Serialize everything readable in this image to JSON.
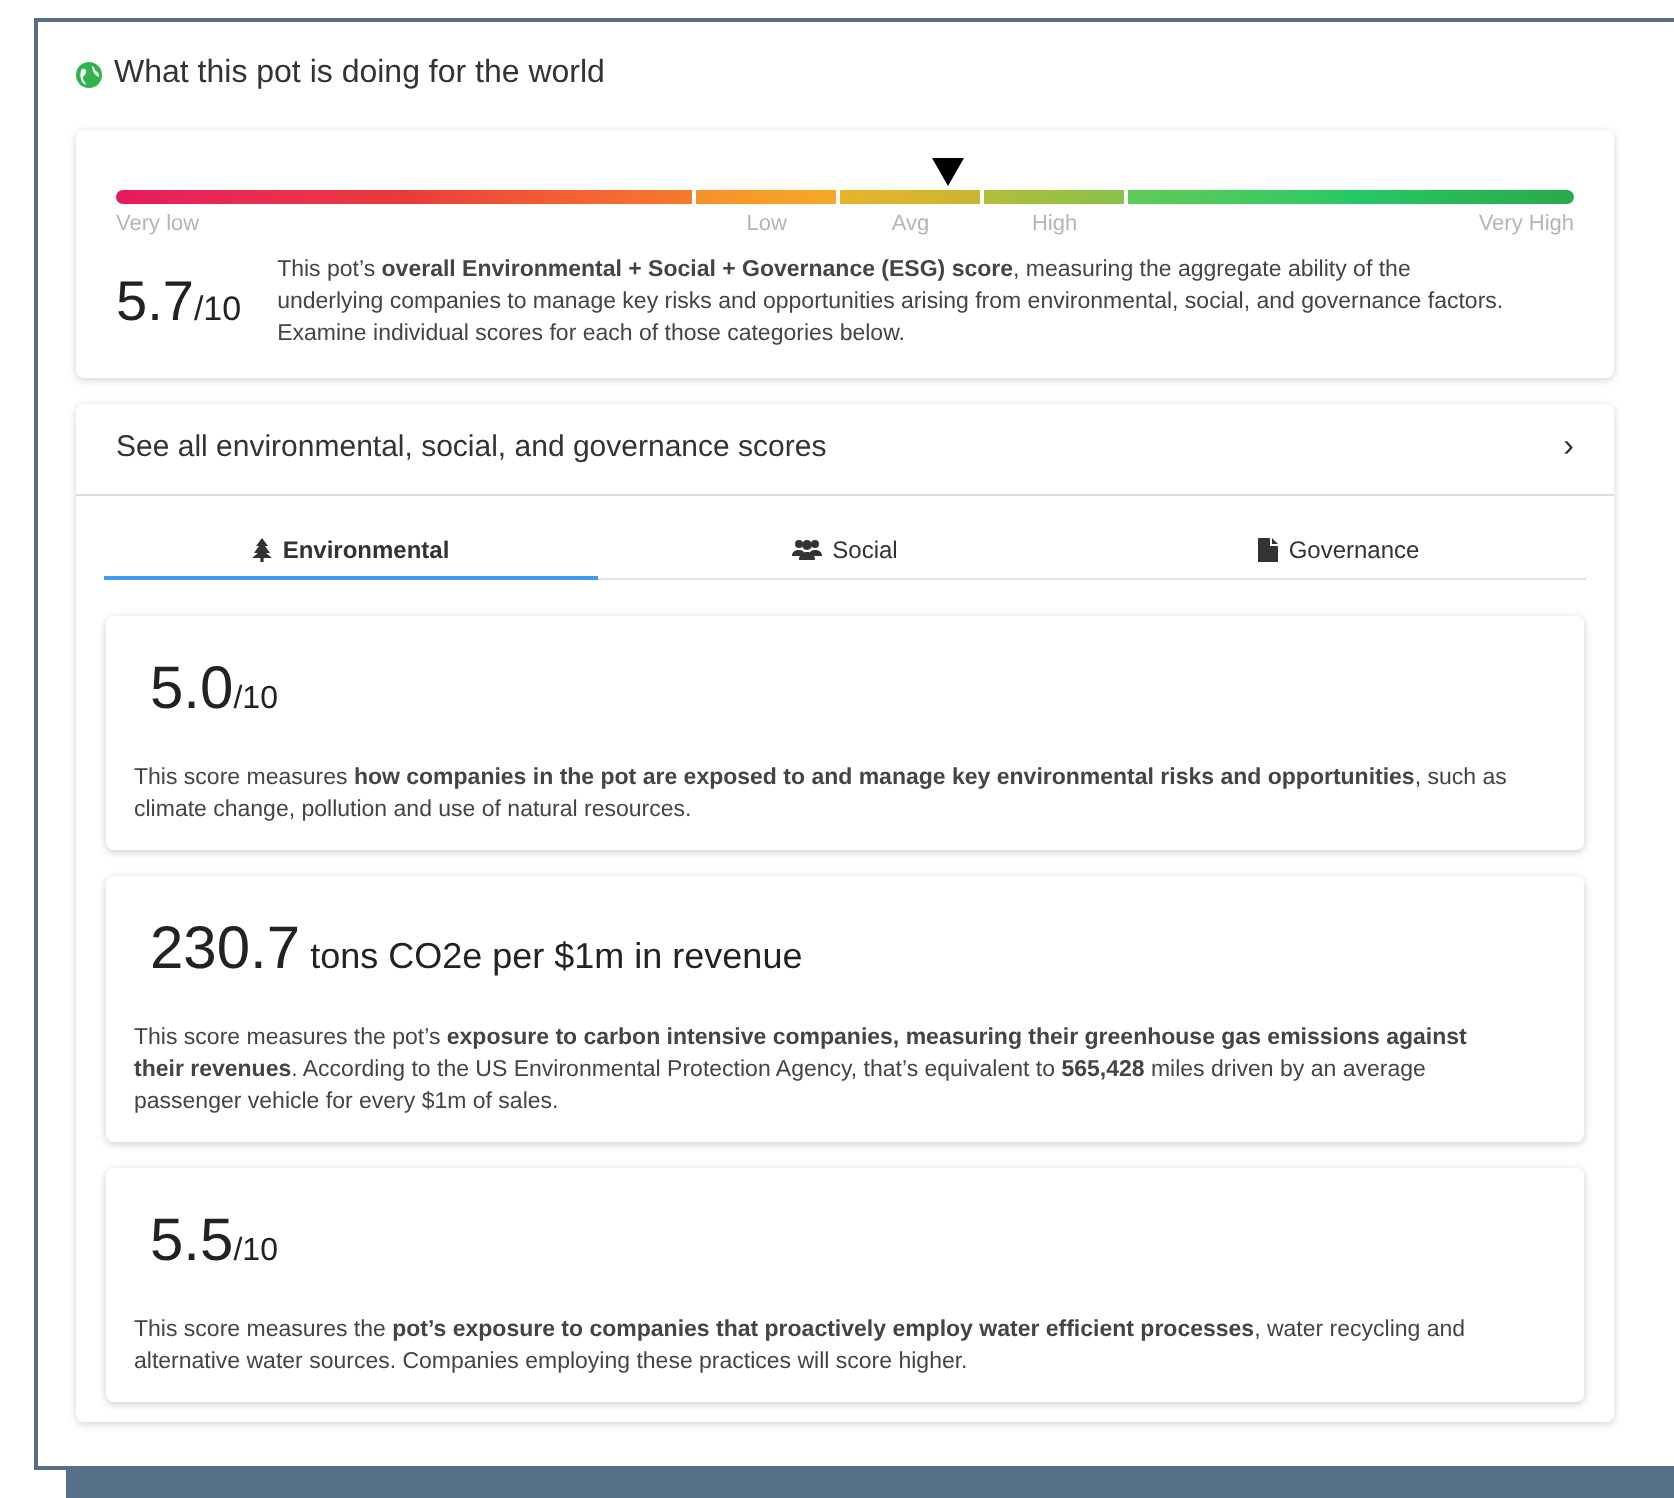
{
  "title": "What this pot is doing for the world",
  "overall": {
    "gauge_labels": [
      "Very low",
      "Low",
      "Avg",
      "High",
      "Very High"
    ],
    "score": "5.7",
    "out_of": "/10",
    "description": "This pot’s **overall Environmental + Social + Governance (ESG) score**, measuring the aggregate ability of the underlying companies to manage key risks and opportunities arising from environmental, social, and governance factors. Examine individual scores for each of those categories below."
  },
  "scores_link": {
    "label": "See all environmental, social, and governance scores",
    "chevron": "›"
  },
  "tabs": [
    {
      "label": "Environmental",
      "kind": "tree",
      "selected": true
    },
    {
      "label": "Social",
      "kind": "people",
      "selected": false
    },
    {
      "label": "Governance",
      "kind": "document",
      "selected": false
    }
  ],
  "cards": [
    {
      "score": "5.0",
      "unit": "/10",
      "kind": "rating",
      "description": "This score measures **how companies in the pot are exposed to and manage key environmental risks and opportunities**, such as climate change, pollution and use of natural resources."
    },
    {
      "score": "230.7",
      "unit": "tons CO2e per $1m in revenue",
      "kind": "measure",
      "description": "This score measures the pot’s **exposure to carbon intensive companies, measuring their greenhouse gas emissions against their revenues**. According to the US Environmental Protection Agency, that’s equivalent to **565,428** miles driven by an average passenger vehicle for every $1m of sales."
    },
    {
      "score": "5.5",
      "unit": "/10",
      "kind": "rating",
      "description": "This score measures the **pot’s exposure to companies that proactively employ water efficient processes**, water recycling and alternative water sources. Companies employing these practices will score higher."
    }
  ]
}
